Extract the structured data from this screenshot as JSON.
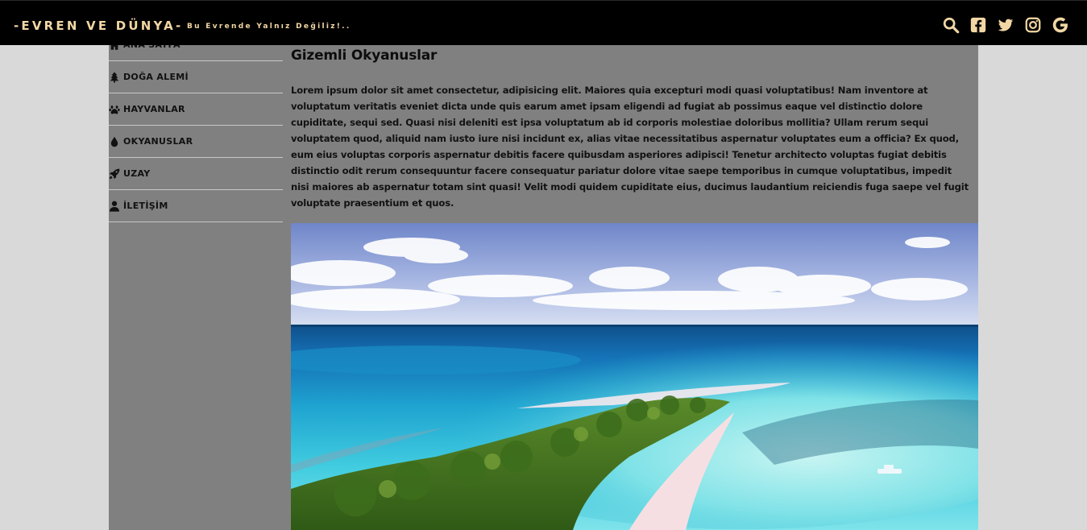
{
  "header": {
    "brand": "-EVREN VE DÜNYA-",
    "tagline": "Bu Evrende Yalnız Değiliz!..",
    "icons": [
      "search-icon",
      "facebook-icon",
      "twitter-icon",
      "instagram-icon",
      "google-icon"
    ]
  },
  "sidebar": {
    "items": [
      {
        "label": "ANA SAYFA",
        "icon": "home-icon"
      },
      {
        "label": "DOĞA ALEMİ",
        "icon": "tree-icon"
      },
      {
        "label": "HAYVANLAR",
        "icon": "paw-icon"
      },
      {
        "label": "OKYANUSLAR",
        "icon": "water-drop-icon"
      },
      {
        "label": "UZAY",
        "icon": "rocket-icon"
      },
      {
        "label": "İLETİŞİM",
        "icon": "user-icon"
      }
    ]
  },
  "main": {
    "title": "Gizemli Okyanuslar",
    "paragraph": "Lorem ipsum dolor sit amet consectetur, adipisicing elit. Maiores quia excepturi modi quasi voluptatibus! Nam inventore at voluptatum veritatis eveniet dicta unde quis earum amet ipsam eligendi ad fugiat ab possimus eaque vel distinctio dolore cupiditate, sequi sed. Quasi nisi deleniti est ipsa voluptatum ab id corporis molestiae doloribus mollitia? Ullam rerum sequi voluptatem quod, aliquid nam iusto iure nisi incidunt ex, alias vitae necessitatibus aspernatur voluptates eum a officia? Ex quod, eum eius voluptas corporis aspernatur debitis facere quibusdam asperiores adipisci! Tenetur architecto voluptas fugiat debitis distinctio odit rerum consequuntur facere consequatur pariatur dolore vitae saepe temporibus in cumque voluptatibus, impedit nisi maiores ab aspernatur totam sint quasi! Velit modi quidem cupiditate eius, ducimus laudantium reiciendis fuga saepe vel fugit voluptate praesentium et quos."
  },
  "colors": {
    "topbar": "#000000",
    "brand": "#f2d7a5",
    "page_bg": "#d9d9d9",
    "content_bg": "#808080"
  }
}
